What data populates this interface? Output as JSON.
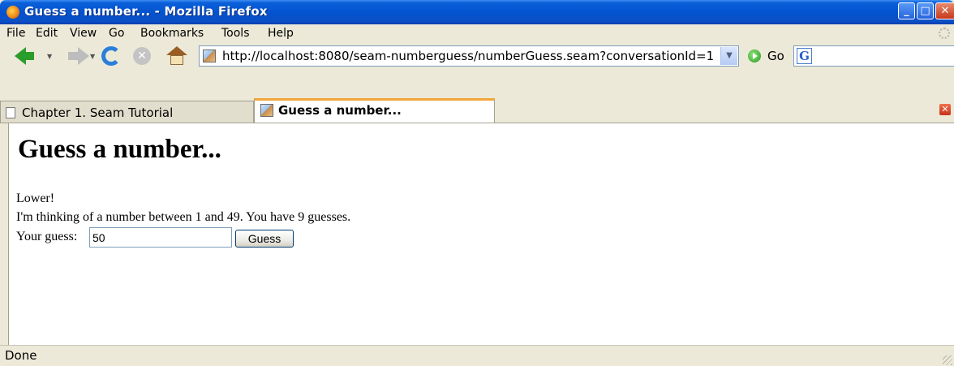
{
  "window": {
    "title": "Guess a number... - Mozilla Firefox",
    "controls": {
      "minimize": "_",
      "maximize": "□",
      "close": "✕"
    }
  },
  "menu": {
    "items": [
      "File",
      "Edit",
      "View",
      "Go",
      "Bookmarks",
      "Tools",
      "Help"
    ]
  },
  "toolbar": {
    "url": "http://localhost:8080/seam-numberguess/numberGuess.seam?conversationId=1",
    "go_label": "Go",
    "search_engine_glyph": "G",
    "icons": [
      "back-icon",
      "forward-icon",
      "reload-icon",
      "stop-icon",
      "home-icon",
      "go-icon",
      "search-engine-icon"
    ]
  },
  "tabs": [
    {
      "label": "Chapter 1. Seam Tutorial",
      "active": false
    },
    {
      "label": "Guess a number...",
      "active": true
    }
  ],
  "page": {
    "heading": "Guess a number...",
    "feedback": "Lower!",
    "info": "I'm thinking of a number between 1 and 49. You have 9 guesses.",
    "guess_label": "Your guess:",
    "guess_value": "50",
    "guess_button": "Guess"
  },
  "status": {
    "text": "Done"
  },
  "colors": {
    "titlebar": "#0453d0",
    "chrome": "#ece9d8",
    "active_tab_accent": "#f2a63a",
    "back_arrow": "#2c9c2c"
  }
}
